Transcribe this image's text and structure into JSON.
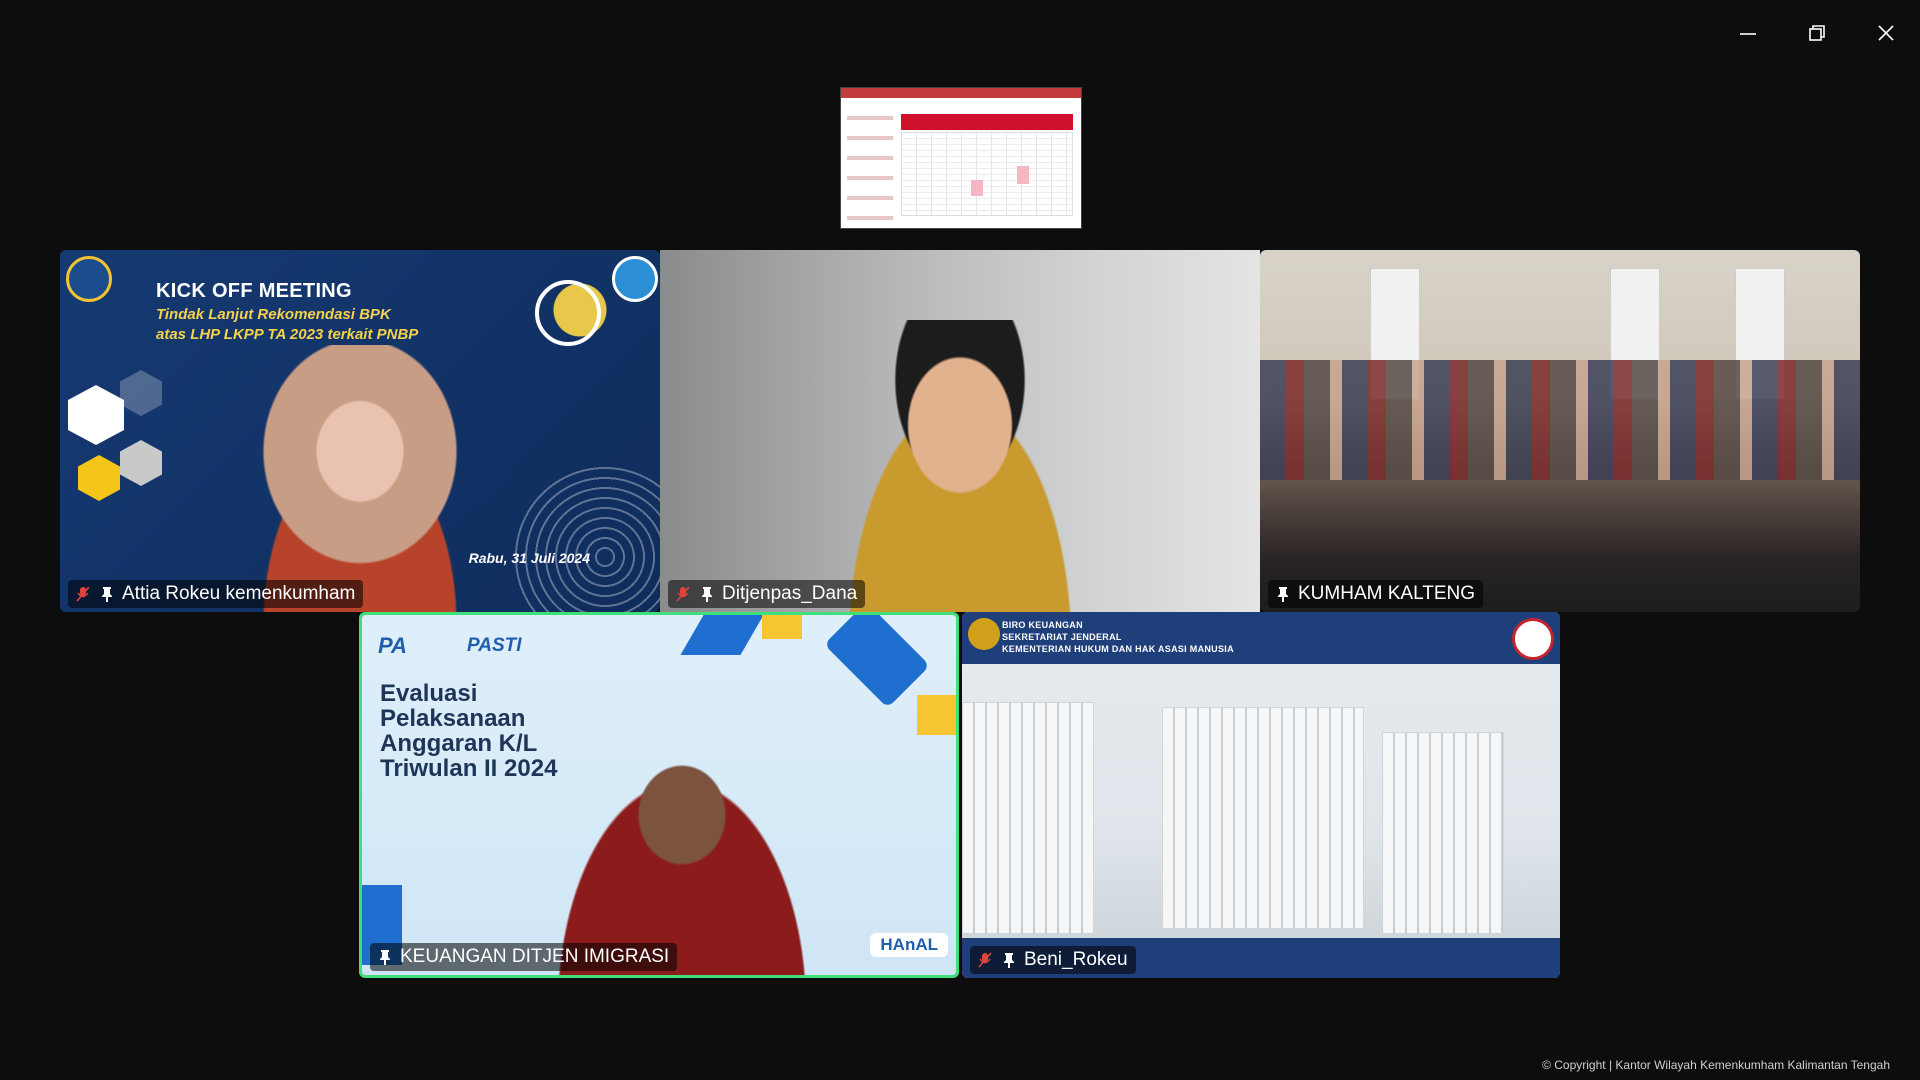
{
  "window_controls": {
    "minimize": "minimize-icon",
    "restore": "restore-icon",
    "close": "close-icon"
  },
  "shared_screen": {
    "icon": "spreadsheet-thumbnail"
  },
  "participants": [
    {
      "name": "Attia Rokeu kemenkumham",
      "muted": true,
      "pinned": true,
      "slide": {
        "title": "KICK OFF MEETING",
        "line1": "Tindak Lanjut Rekomendasi BPK",
        "line2": "atas LHP LKPP TA 2023 terkait PNBP",
        "date": "Rabu, 31 Juli 2024"
      }
    },
    {
      "name": "Ditjenpas_Dana",
      "muted": true,
      "pinned": true
    },
    {
      "name": "KUMHAM KALTENG",
      "muted": false,
      "pinned": true
    },
    {
      "name": "KEUANGAN DITJEN IMIGRASI",
      "muted": false,
      "pinned": true,
      "active_speaker": true,
      "slide": {
        "brand1": "PA",
        "brand2": "PASTI",
        "title": [
          "Evaluasi",
          "Pelaksanaan",
          "Anggaran K/L",
          "Triwulan II 2024"
        ],
        "badge": "HAnAL"
      }
    },
    {
      "name": "Beni_Rokeu",
      "muted": true,
      "pinned": true,
      "slide": {
        "lines": [
          "BIRO KEUANGAN",
          "SEKRETARIAT JENDERAL",
          "KEMENTERIAN HUKUM DAN HAK ASASI MANUSIA"
        ]
      }
    }
  ],
  "colors": {
    "active_speaker_border": "#3ee07a",
    "mute_icon": "#e0443e"
  },
  "footer": {
    "copyright": "© Copyright | Kantor Wilayah Kemenkumham Kalimantan Tengah"
  }
}
